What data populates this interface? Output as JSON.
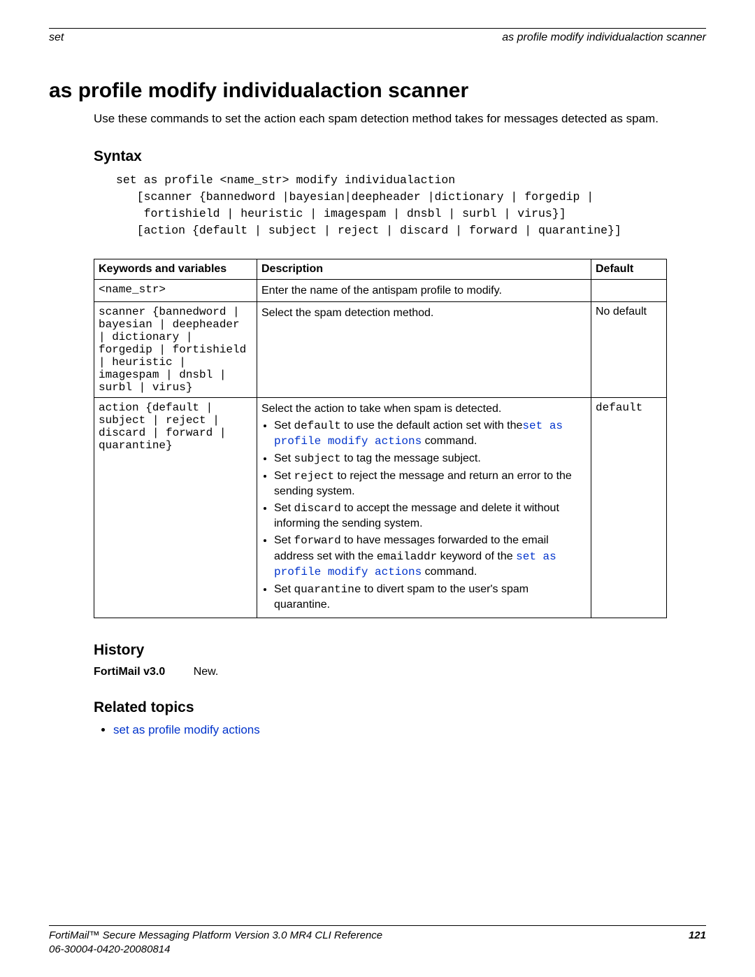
{
  "header": {
    "left": "set",
    "right": "as profile modify individualaction scanner"
  },
  "title": "as profile modify individualaction scanner",
  "intro": "Use these commands to set the action each spam detection method takes for messages detected as spam.",
  "syntax": {
    "heading": "Syntax",
    "code": "set as profile <name_str> modify individualaction\n   [scanner {bannedword |bayesian|deepheader |dictionary | forgedip |\n    fortishield | heuristic | imagespam | dnsbl | surbl | virus}]\n   [action {default | subject | reject | discard | forward | quarantine}]"
  },
  "table": {
    "headers": {
      "kv": "Keywords and variables",
      "desc": "Description",
      "def": "Default"
    },
    "rows": [
      {
        "kv": "<name_str>",
        "desc_plain": "Enter the name of the antispam profile to modify.",
        "def": ""
      },
      {
        "kv": "scanner {bannedword | bayesian | deepheader | dictionary | forgedip | fortishield | heuristic | imagespam | dnsbl | surbl | virus}",
        "desc_plain": "Select the spam detection method.",
        "def": "No default"
      },
      {
        "kv": "action {default | subject | reject | discard | forward | quarantine}",
        "desc_intro": "Select the action to take when spam is detected.",
        "bullets": [
          {
            "pre": "Set ",
            "code": "default",
            "mid": " to use the default action set with the",
            "link": "set as profile modify actions",
            "post": " command."
          },
          {
            "pre": "Set ",
            "code": "subject",
            "post": " to tag the message subject."
          },
          {
            "pre": "Set ",
            "code": "reject",
            "post": " to reject the message and return an error to the sending system."
          },
          {
            "pre": "Set ",
            "code": "discard",
            "post": " to accept the message and delete it without informing the sending system."
          },
          {
            "pre": "Set ",
            "code": "forward",
            "mid": " to have messages forwarded to the email address set with the ",
            "code2": "emailaddr",
            "mid2": " keyword of the ",
            "link": "set as profile modify actions",
            "post": " command."
          },
          {
            "pre": "Set ",
            "code": "quarantine",
            "post": " to divert spam to the user's spam quarantine."
          }
        ],
        "def": "default"
      }
    ]
  },
  "history": {
    "heading": "History",
    "version": "FortiMail v3.0",
    "note": "New."
  },
  "related": {
    "heading": "Related topics",
    "items": [
      {
        "label": "set as profile modify actions"
      }
    ]
  },
  "footer": {
    "line1": "FortiMail™ Secure Messaging Platform Version 3.0 MR4 CLI Reference",
    "line2": "06-30004-0420-20080814",
    "page": "121"
  }
}
